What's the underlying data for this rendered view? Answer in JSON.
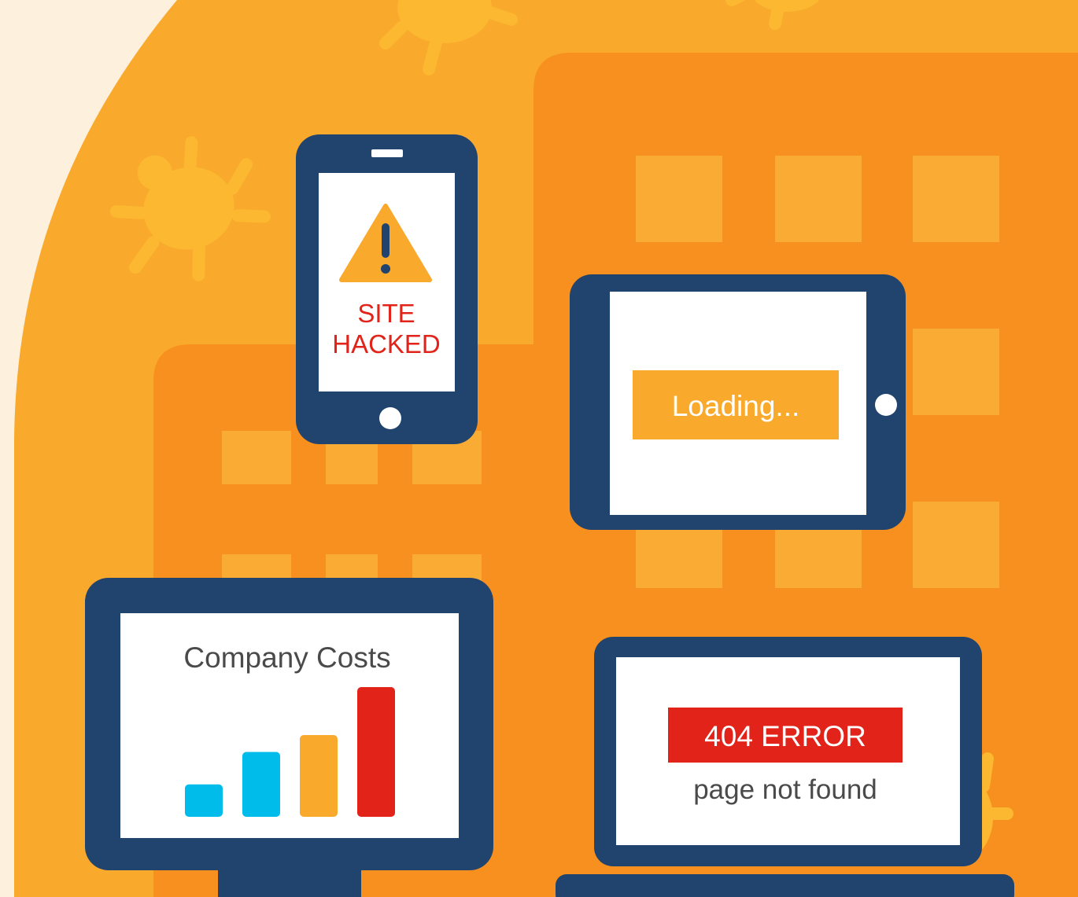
{
  "colors": {
    "background_cream": "#fdf0dc",
    "blob_light_orange": "#f9a92c",
    "building_orange": "#f7901e",
    "window_square": "#f9ab33",
    "bug_yellow": "#fbb830",
    "device_navy": "#21446f",
    "screen_white": "#ffffff",
    "alert_red": "#e2231a",
    "bar_cyan": "#00bceb",
    "bar_orange": "#f9a92c"
  },
  "phone": {
    "icon": "warning-triangle-icon",
    "line1": "SITE",
    "line2": "HACKED"
  },
  "tablet": {
    "loading_text": "Loading..."
  },
  "monitor": {
    "title": "Company Costs",
    "bar_colors": [
      "#00bceb",
      "#00bceb",
      "#f9a92c",
      "#e2231a"
    ],
    "bar_levels": [
      0.25,
      0.5,
      0.63,
      1.0
    ]
  },
  "laptop": {
    "error_code": "404 ERROR",
    "error_message": "page not found"
  },
  "decor_icons": [
    "bug-icon",
    "bug-icon",
    "bug-icon",
    "bug-icon"
  ]
}
